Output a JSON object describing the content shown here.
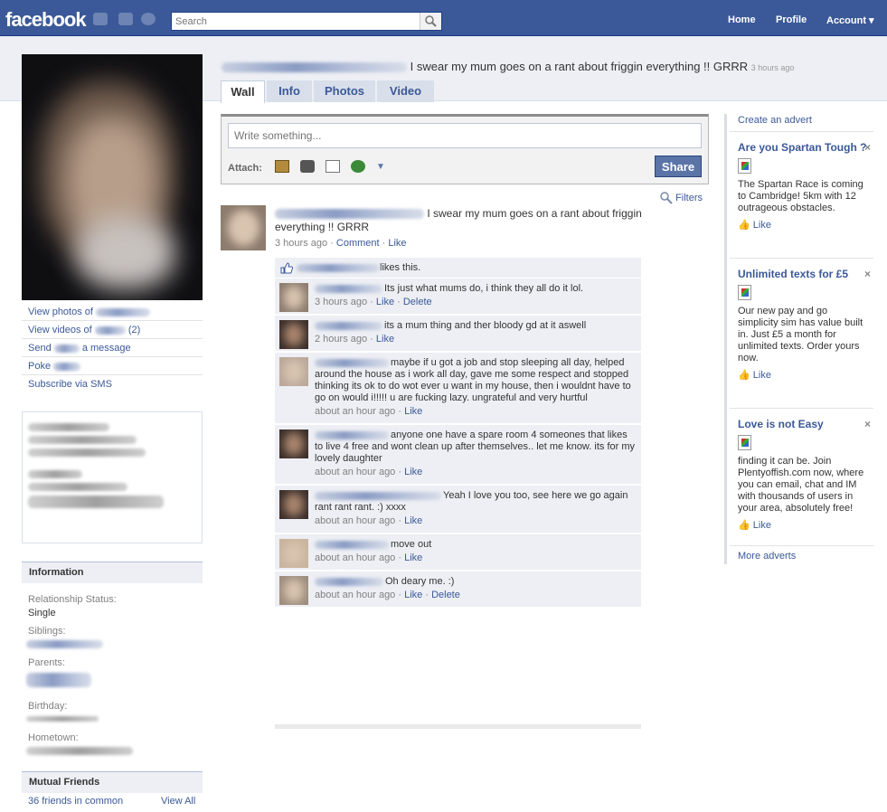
{
  "topbar": {
    "logo": "facebook",
    "search_placeholder": "Search",
    "nav": [
      "Home",
      "Profile",
      "Account ▾"
    ]
  },
  "status": {
    "text": "I swear my mum goes on a rant about friggin everything !! GRRR",
    "time": "3 hours ago"
  },
  "tabs": [
    "Wall",
    "Info",
    "Photos",
    "Video"
  ],
  "composer": {
    "placeholder": "Write something...",
    "attach_label": "Attach:",
    "share_label": "Share"
  },
  "filters_label": "Filters",
  "post": {
    "text": "I swear my mum goes on a rant about friggin everything !! GRRR",
    "time": "3 hours ago",
    "comment_link": "Comment",
    "like_link": "Like",
    "likes_text": "likes this."
  },
  "comments": [
    {
      "text": "Its just what mums do, i think they all do it lol.",
      "time": "3 hours ago",
      "links": [
        "Like",
        "Delete"
      ]
    },
    {
      "text": "its a mum thing and ther bloody gd at it aswell",
      "time": "2 hours ago",
      "links": [
        "Like"
      ]
    },
    {
      "text": "maybe if u got a job and stop sleeping all day, helped around the house as i work all day, gave me some respect and stopped thinking its ok to do wot ever u want in my house, then i wouldnt have to go on would i!!!!! u are fucking lazy. ungrateful and very hurtful",
      "time": "about an hour ago",
      "links": [
        "Like"
      ]
    },
    {
      "text": "anyone one have a spare room 4 someones that likes to live 4 free and wont clean up after themselves.. let me know. its for my lovely daughter",
      "time": "about an hour ago",
      "links": [
        "Like"
      ]
    },
    {
      "text": "Yeah I love you too, see here we go again rant rant rant. :) xxxx",
      "time": "about an hour ago",
      "links": [
        "Like"
      ]
    },
    {
      "text": "move out",
      "time": "about an hour ago",
      "links": [
        "Like"
      ]
    },
    {
      "text": "Oh deary me. :)",
      "time": "about an hour ago",
      "links": [
        "Like",
        "Delete"
      ]
    }
  ],
  "left": {
    "links": [
      "View photos of",
      "View videos of",
      "Send",
      "Poke",
      "Subscribe via SMS"
    ],
    "videos_count": "(2)",
    "send_suffix": "a message",
    "info_title": "Information",
    "relationship_label": "Relationship Status:",
    "relationship_value": "Single",
    "siblings_label": "Siblings:",
    "parents_label": "Parents:",
    "birthday_label": "Birthday:",
    "hometown_label": "Hometown:",
    "mutual_title": "Mutual Friends",
    "mutual_count": "36 friends in common",
    "view_all": "View All"
  },
  "ads": {
    "create": "Create an advert",
    "more": "More adverts",
    "items": [
      {
        "title": "Are you Spartan Tough ?",
        "body": "The Spartan Race is coming to Cambridge! 5km with 12 outrageous obstacles.",
        "like": "Like"
      },
      {
        "title": "Unlimited texts for £5",
        "body": "Our new pay and go simplicity sim has value built in. Just £5 a month for unlimited texts. Order yours now.",
        "like": "Like"
      },
      {
        "title": "Love is not Easy",
        "body": "finding it can be. Join Plentyoffish.com now, where you can email, chat and IM with thousands of users in your area, absolutely free!",
        "like": "Like"
      }
    ]
  }
}
